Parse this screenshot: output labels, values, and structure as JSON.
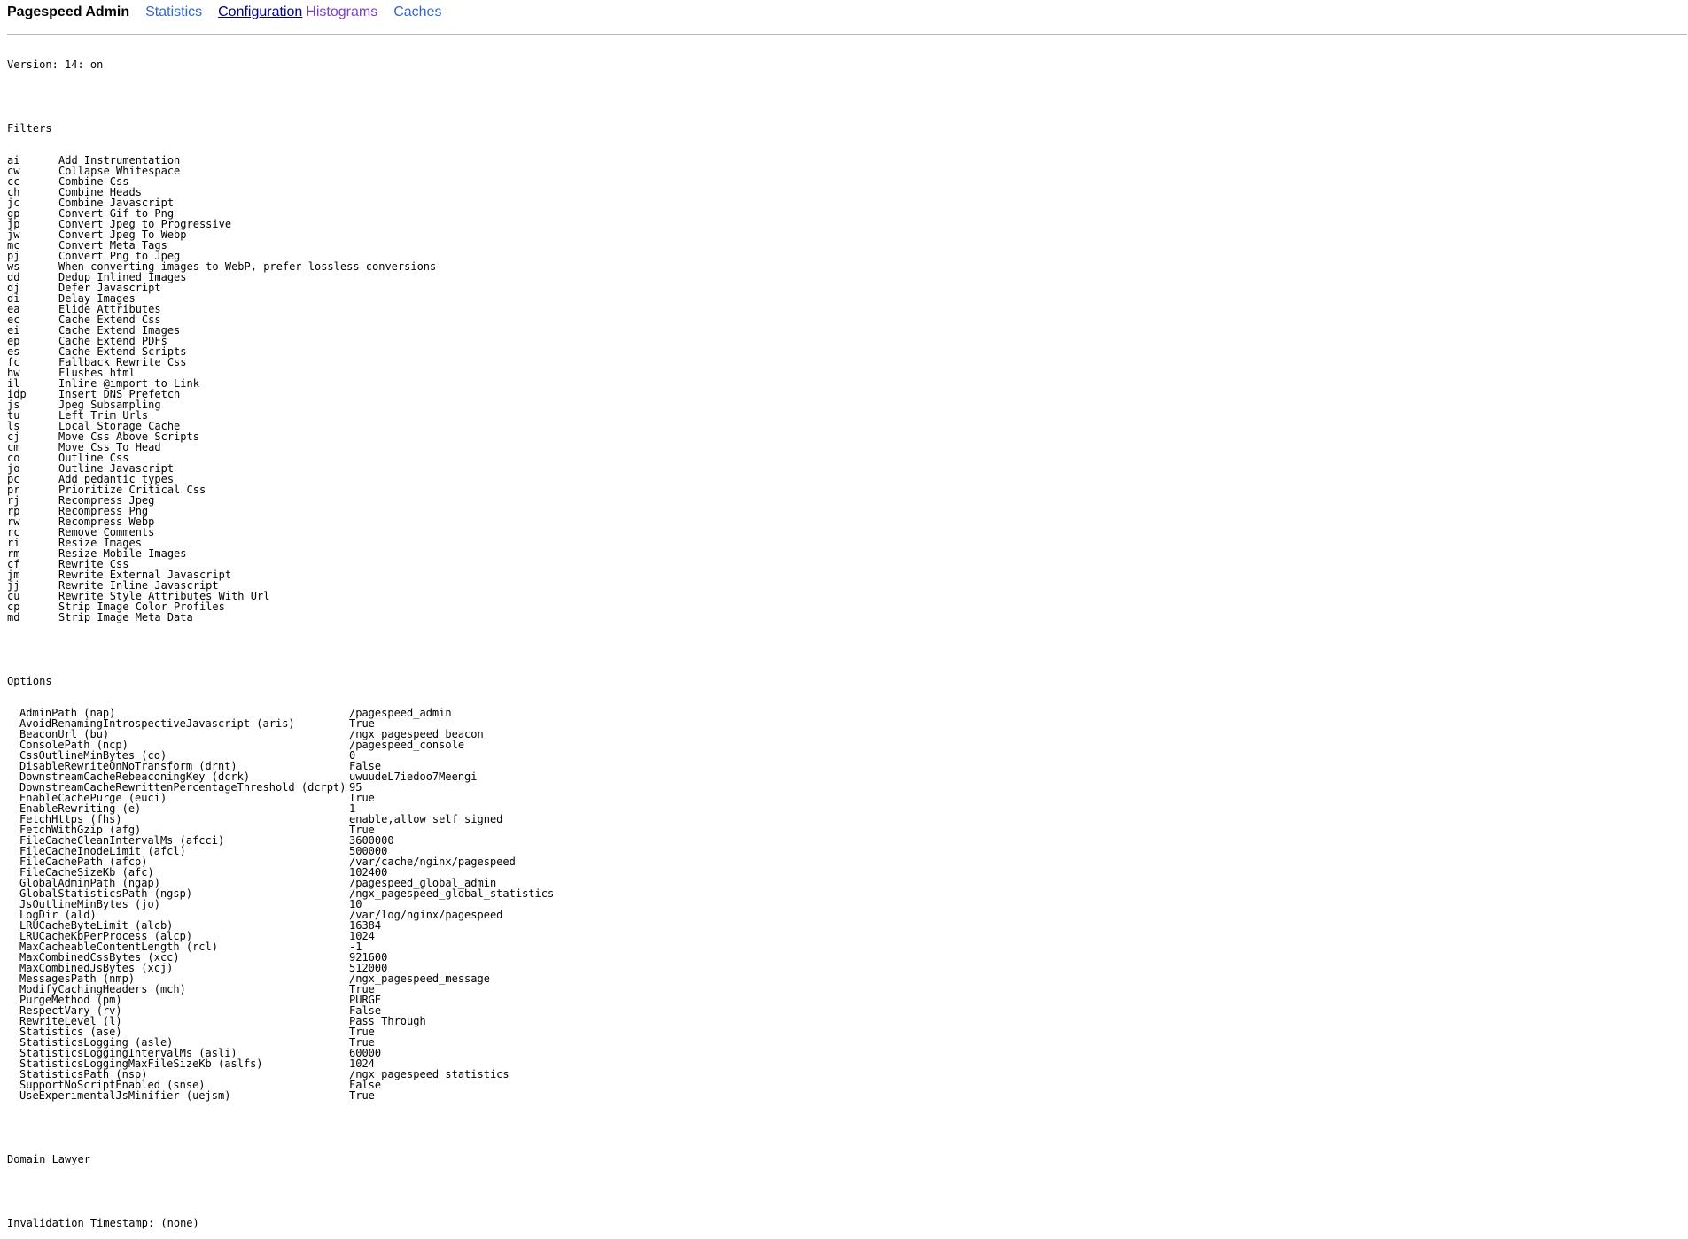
{
  "header": {
    "title": "Pagespeed Admin",
    "nav": [
      {
        "label": "Statistics",
        "state": "link"
      },
      {
        "label": "Configuration",
        "state": "active"
      },
      {
        "label": "Histograms",
        "state": "visited"
      },
      {
        "label": "Caches",
        "state": "link"
      }
    ]
  },
  "version_line": "Version: 14: on",
  "filters": {
    "heading": "Filters",
    "items": [
      {
        "code": "ai",
        "name": "Add Instrumentation"
      },
      {
        "code": "cw",
        "name": "Collapse Whitespace"
      },
      {
        "code": "cc",
        "name": "Combine Css"
      },
      {
        "code": "ch",
        "name": "Combine Heads"
      },
      {
        "code": "jc",
        "name": "Combine Javascript"
      },
      {
        "code": "gp",
        "name": "Convert Gif to Png"
      },
      {
        "code": "jp",
        "name": "Convert Jpeg to Progressive"
      },
      {
        "code": "jw",
        "name": "Convert Jpeg To Webp"
      },
      {
        "code": "mc",
        "name": "Convert Meta Tags"
      },
      {
        "code": "pj",
        "name": "Convert Png to Jpeg"
      },
      {
        "code": "ws",
        "name": "When converting images to WebP, prefer lossless conversions"
      },
      {
        "code": "dd",
        "name": "Dedup Inlined Images"
      },
      {
        "code": "dj",
        "name": "Defer Javascript"
      },
      {
        "code": "di",
        "name": "Delay Images"
      },
      {
        "code": "ea",
        "name": "Elide Attributes"
      },
      {
        "code": "ec",
        "name": "Cache Extend Css"
      },
      {
        "code": "ei",
        "name": "Cache Extend Images"
      },
      {
        "code": "ep",
        "name": "Cache Extend PDFs"
      },
      {
        "code": "es",
        "name": "Cache Extend Scripts"
      },
      {
        "code": "fc",
        "name": "Fallback Rewrite Css"
      },
      {
        "code": "hw",
        "name": "Flushes html"
      },
      {
        "code": "il",
        "name": "Inline @import to Link"
      },
      {
        "code": "idp",
        "name": "Insert DNS Prefetch"
      },
      {
        "code": "js",
        "name": "Jpeg Subsampling"
      },
      {
        "code": "tu",
        "name": "Left Trim Urls"
      },
      {
        "code": "ls",
        "name": "Local Storage Cache"
      },
      {
        "code": "cj",
        "name": "Move Css Above Scripts"
      },
      {
        "code": "cm",
        "name": "Move Css To Head"
      },
      {
        "code": "co",
        "name": "Outline Css"
      },
      {
        "code": "jo",
        "name": "Outline Javascript"
      },
      {
        "code": "pc",
        "name": "Add pedantic types"
      },
      {
        "code": "pr",
        "name": "Prioritize Critical Css"
      },
      {
        "code": "rj",
        "name": "Recompress Jpeg"
      },
      {
        "code": "rp",
        "name": "Recompress Png"
      },
      {
        "code": "rw",
        "name": "Recompress Webp"
      },
      {
        "code": "rc",
        "name": "Remove Comments"
      },
      {
        "code": "ri",
        "name": "Resize Images"
      },
      {
        "code": "rm",
        "name": "Resize Mobile Images"
      },
      {
        "code": "cf",
        "name": "Rewrite Css"
      },
      {
        "code": "jm",
        "name": "Rewrite External Javascript"
      },
      {
        "code": "jj",
        "name": "Rewrite Inline Javascript"
      },
      {
        "code": "cu",
        "name": "Rewrite Style Attributes With Url"
      },
      {
        "code": "cp",
        "name": "Strip Image Color Profiles"
      },
      {
        "code": "md",
        "name": "Strip Image Meta Data"
      }
    ]
  },
  "options": {
    "heading": "Options",
    "items": [
      {
        "name": "AdminPath (nap)",
        "value": "/pagespeed_admin"
      },
      {
        "name": "AvoidRenamingIntrospectiveJavascript (aris)",
        "value": "True"
      },
      {
        "name": "BeaconUrl (bu)",
        "value": "/ngx_pagespeed_beacon"
      },
      {
        "name": "ConsolePath (ncp)",
        "value": "/pagespeed_console"
      },
      {
        "name": "CssOutlineMinBytes (co)",
        "value": "0"
      },
      {
        "name": "DisableRewriteOnNoTransform (drnt)",
        "value": "False"
      },
      {
        "name": "DownstreamCacheRebeaconingKey (dcrk)",
        "value": "uwuudeL7iedoo7Meengi"
      },
      {
        "name": "DownstreamCacheRewrittenPercentageThreshold (dcrpt)",
        "value": "95"
      },
      {
        "name": "EnableCachePurge (euci)",
        "value": "True"
      },
      {
        "name": "EnableRewriting (e)",
        "value": "1"
      },
      {
        "name": "FetchHttps (fhs)",
        "value": "enable,allow_self_signed"
      },
      {
        "name": "FetchWithGzip (afg)",
        "value": "True"
      },
      {
        "name": "FileCacheCleanIntervalMs (afcci)",
        "value": "3600000"
      },
      {
        "name": "FileCacheInodeLimit (afcl)",
        "value": "500000"
      },
      {
        "name": "FileCachePath (afcp)",
        "value": "/var/cache/nginx/pagespeed"
      },
      {
        "name": "FileCacheSizeKb (afc)",
        "value": "102400"
      },
      {
        "name": "GlobalAdminPath (ngap)",
        "value": "/pagespeed_global_admin"
      },
      {
        "name": "GlobalStatisticsPath (ngsp)",
        "value": "/ngx_pagespeed_global_statistics"
      },
      {
        "name": "JsOutlineMinBytes (jo)",
        "value": "10"
      },
      {
        "name": "LogDir (ald)",
        "value": "/var/log/nginx/pagespeed"
      },
      {
        "name": "LRUCacheByteLimit (alcb)",
        "value": "16384"
      },
      {
        "name": "LRUCacheKbPerProcess (alcp)",
        "value": "1024"
      },
      {
        "name": "MaxCacheableContentLength (rcl)",
        "value": "-1"
      },
      {
        "name": "MaxCombinedCssBytes (xcc)",
        "value": "921600"
      },
      {
        "name": "MaxCombinedJsBytes (xcj)",
        "value": "512000"
      },
      {
        "name": "MessagesPath (nmp)",
        "value": "/ngx_pagespeed_message"
      },
      {
        "name": "ModifyCachingHeaders (mch)",
        "value": "True"
      },
      {
        "name": "PurgeMethod (pm)",
        "value": "PURGE"
      },
      {
        "name": "RespectVary (rv)",
        "value": "False"
      },
      {
        "name": "RewriteLevel (l)",
        "value": "Pass Through"
      },
      {
        "name": "Statistics (ase)",
        "value": "True"
      },
      {
        "name": "StatisticsLogging (asle)",
        "value": "True"
      },
      {
        "name": "StatisticsLoggingIntervalMs (asli)",
        "value": "60000"
      },
      {
        "name": "StatisticsLoggingMaxFileSizeKb (aslfs)",
        "value": "1024"
      },
      {
        "name": "StatisticsPath (nsp)",
        "value": "/ngx_pagespeed_statistics"
      },
      {
        "name": "SupportNoScriptEnabled (snse)",
        "value": "False"
      },
      {
        "name": "UseExperimentalJsMinifier (uejsm)",
        "value": "True"
      }
    ]
  },
  "domain_lawyer": "Domain Lawyer",
  "invalidation_line": "Invalidation Timestamp: (none)"
}
